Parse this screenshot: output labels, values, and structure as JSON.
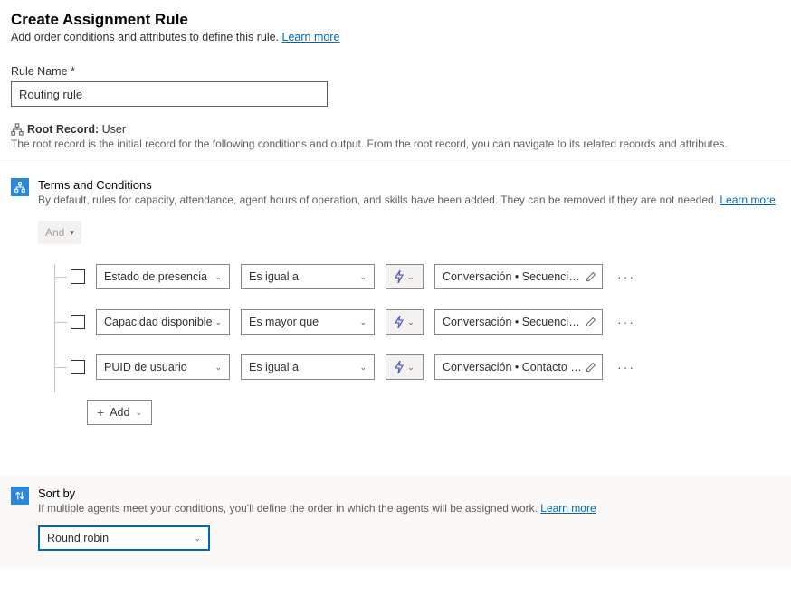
{
  "header": {
    "title": "Create Assignment Rule",
    "subtitle": "Add order conditions and attributes to define this rule.",
    "learn_more": "Learn more"
  },
  "rule_name": {
    "label": "Rule Name *",
    "value": "Routing rule"
  },
  "root_record": {
    "label": "Root Record:",
    "value": "User",
    "description": "The root record is the initial record for the following conditions and output. From the root record, you can navigate to its related records and attributes."
  },
  "terms": {
    "title": "Terms and Conditions",
    "subtitle": "By default, rules for capacity, attendance, agent hours of operation, and skills have been added. They can be removed if they are not needed.",
    "learn_more": "Learn more",
    "group_operator": "And",
    "rows": [
      {
        "attr": "Estado de presencia",
        "op": "Es igual a",
        "val": "Conversación • Secuencia de tra..."
      },
      {
        "attr": "Capacidad disponible",
        "op": "Es mayor que",
        "val": "Conversación • Secuencia de tra..."
      },
      {
        "attr": "PUID de usuario",
        "op": "Es igual a",
        "val": "Conversación • Contacto • Usuari..."
      }
    ],
    "add_label": "Add"
  },
  "sort": {
    "title": "Sort by",
    "subtitle": "If multiple agents meet your conditions, you'll define the order in which the agents will be assigned work.",
    "learn_more": "Learn more",
    "value": "Round robin"
  }
}
